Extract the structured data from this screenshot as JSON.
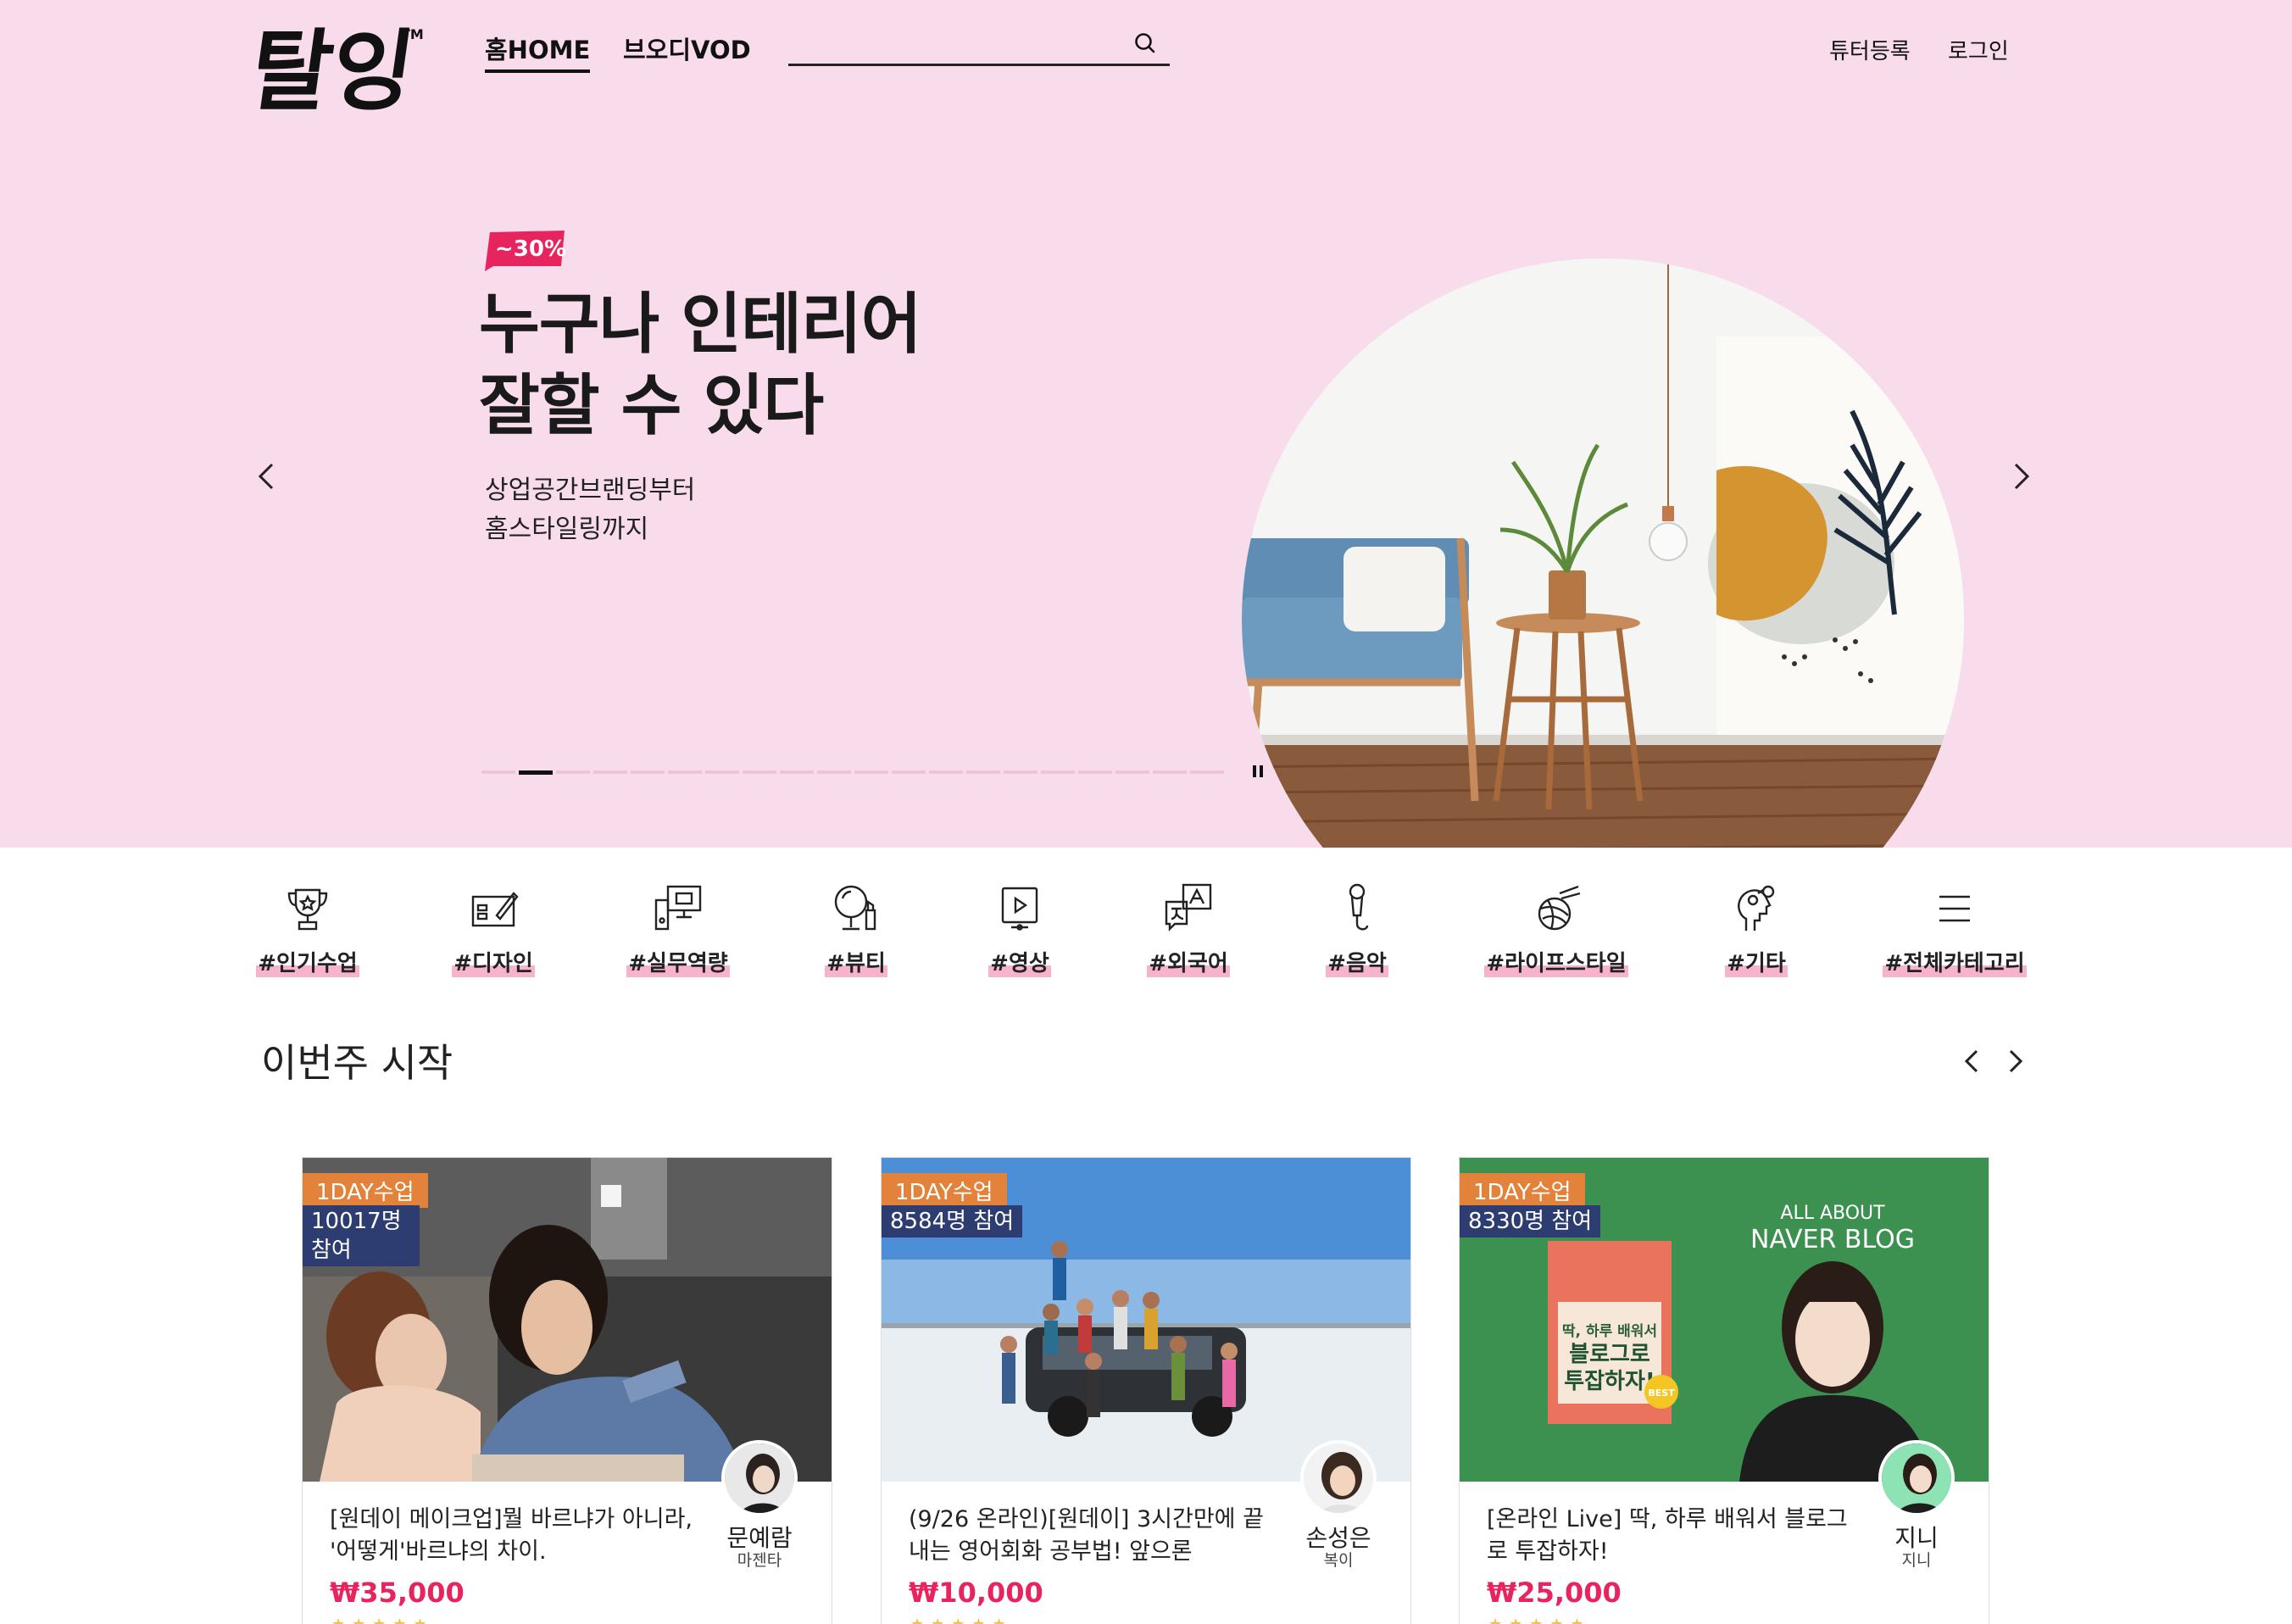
{
  "header": {
    "logo_text": "탈잉",
    "nav": [
      {
        "label": "홈HOME",
        "active": true
      },
      {
        "label": "브오디VOD",
        "active": false
      }
    ],
    "search_placeholder": "",
    "tutor_register": "튜터등록",
    "login": "로그인"
  },
  "hero": {
    "badge": "~30%",
    "title_line1": "누구나 인테리어",
    "title_line2": "잘할 수 있다",
    "sub_line1": "상업공간브랜딩부터",
    "sub_line2": "홈스타일링까지",
    "slide_count": 20,
    "active_slide": 2,
    "background": "#f8dceb"
  },
  "categories": [
    {
      "label": "#인기수업",
      "icon": "trophy-icon"
    },
    {
      "label": "#디자인",
      "icon": "design-icon"
    },
    {
      "label": "#실무역량",
      "icon": "computer-icon"
    },
    {
      "label": "#뷰티",
      "icon": "mirror-icon"
    },
    {
      "label": "#영상",
      "icon": "video-icon"
    },
    {
      "label": "#외국어",
      "icon": "translate-icon"
    },
    {
      "label": "#음악",
      "icon": "microphone-icon"
    },
    {
      "label": "#라이프스타일",
      "icon": "yarn-icon"
    },
    {
      "label": "#기타",
      "icon": "idea-head-icon"
    },
    {
      "label": "#전체카테고리",
      "icon": "menu-icon"
    }
  ],
  "section": {
    "title": "이번주 시작"
  },
  "cards": [
    {
      "type": "1DAY수업",
      "count": "10017명 참여",
      "title": "[원데이 메이크업]뭘 바르냐가 아니라, '어떻게'바르냐의 차이.",
      "tutor": "문예람",
      "role": "마젠타",
      "price": "₩35,000",
      "stars": "★★★★★"
    },
    {
      "type": "1DAY수업",
      "count": "8584명 참여",
      "title": "(9/26 온라인)[원데이] 3시간만에 끝내는 영어회화 공부법! 앞으론",
      "tutor": "손성은",
      "role": "복이",
      "price": "₩10,000",
      "stars": "★★★★★"
    },
    {
      "type": "1DAY수업",
      "count": "8330명 참여",
      "title": "[온라인 Live] 딱, 하루 배워서 블로그로 투잡하자!",
      "tutor": "지니",
      "role": "지니",
      "price": "₩25,000",
      "stars": "★★★★★",
      "image_text": {
        "line1": "ALL ABOUT",
        "line2": "NAVER BLOG",
        "book1": "딱, 하루 배워서",
        "book2": "블로그로",
        "book3": "투잡하자!",
        "best": "BEST"
      }
    }
  ],
  "colors": {
    "accent": "#e8245f",
    "tag_orange": "#e3823a",
    "tag_navy": "#2e3d71",
    "blog_green": "#3c9150"
  }
}
